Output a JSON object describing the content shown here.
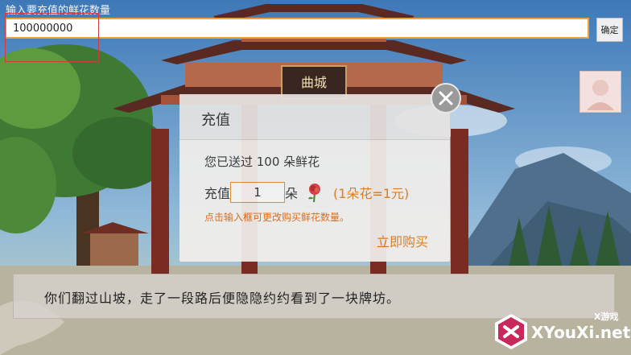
{
  "top_input": {
    "label": "输入要充值的鲜花数量",
    "value": "100000000",
    "confirm_label": "确定"
  },
  "dialog": {
    "title": "充值",
    "sent_text": "您已送过 100 朵鲜花",
    "qty_label": "充值",
    "qty_value": "1",
    "unit": "朵",
    "rate": "(1朵花=1元)",
    "hint": "点击输入框可更改购买鲜花数量。",
    "buy_label": "立即购买"
  },
  "story": {
    "text": "你们翻过山坡，走了一段路后便隐隐约约看到了一块牌坊。"
  },
  "scene": {
    "gate_sign": "曲城"
  },
  "watermark": {
    "small": "X游戏",
    "main": "XYouXi.net"
  },
  "colors": {
    "accent_orange": "#e37a17",
    "input_border": "#f0a038",
    "annotation_red": "#d23b3b"
  }
}
